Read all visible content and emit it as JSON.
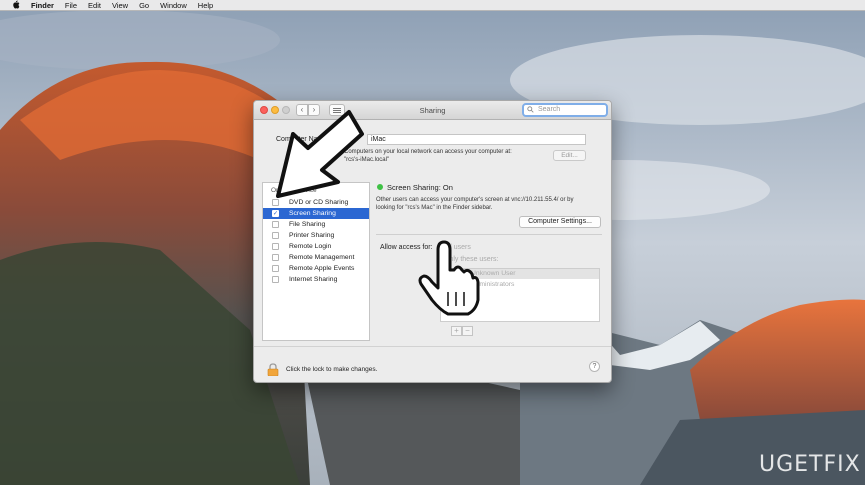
{
  "menubar": {
    "app_name": "Finder",
    "items": [
      "File",
      "Edit",
      "View",
      "Go",
      "Window",
      "Help"
    ]
  },
  "window": {
    "title": "Sharing",
    "search_placeholder": "Search"
  },
  "computer": {
    "name_label": "Computer Name:",
    "name_value": "iMac",
    "network_line1": "Computers on your local network can access your computer at:",
    "network_line2": "\"rcs's-iMac.local\"",
    "edit_label": "Edit..."
  },
  "services": {
    "header_on": "On",
    "header_service": "Service",
    "items": [
      {
        "label": "DVD or CD Sharing",
        "checked": false,
        "selected": false
      },
      {
        "label": "Screen Sharing",
        "checked": true,
        "selected": true
      },
      {
        "label": "File Sharing",
        "checked": false,
        "selected": false
      },
      {
        "label": "Printer Sharing",
        "checked": false,
        "selected": false
      },
      {
        "label": "Remote Login",
        "checked": false,
        "selected": false
      },
      {
        "label": "Remote Management",
        "checked": false,
        "selected": false
      },
      {
        "label": "Remote Apple Events",
        "checked": false,
        "selected": false
      },
      {
        "label": "Internet Sharing",
        "checked": false,
        "selected": false
      }
    ]
  },
  "detail": {
    "status": "Screen Sharing: On",
    "desc_line1": "Other users can access your computer's screen at vnc://10.211.55.4/ or by",
    "desc_line2": "looking for \"rcs's Mac\" in the Finder sidebar.",
    "computer_settings_label": "Computer Settings...",
    "allow_access_label": "Allow access for:",
    "all_users": "All users",
    "only_these_users": "Only these users:",
    "users": [
      "Unknown User",
      "Administrators"
    ],
    "add_label": "+",
    "remove_label": "−"
  },
  "footer": {
    "lock_text": "Click the lock to make changes.",
    "help_label": "?"
  },
  "watermark": {
    "text_a": "UG",
    "text_b": "ET",
    "text_c": "FIX"
  },
  "colors": {
    "selection": "#2b67d2",
    "status_on": "#3fc145",
    "search_ring": "#80aee8"
  }
}
